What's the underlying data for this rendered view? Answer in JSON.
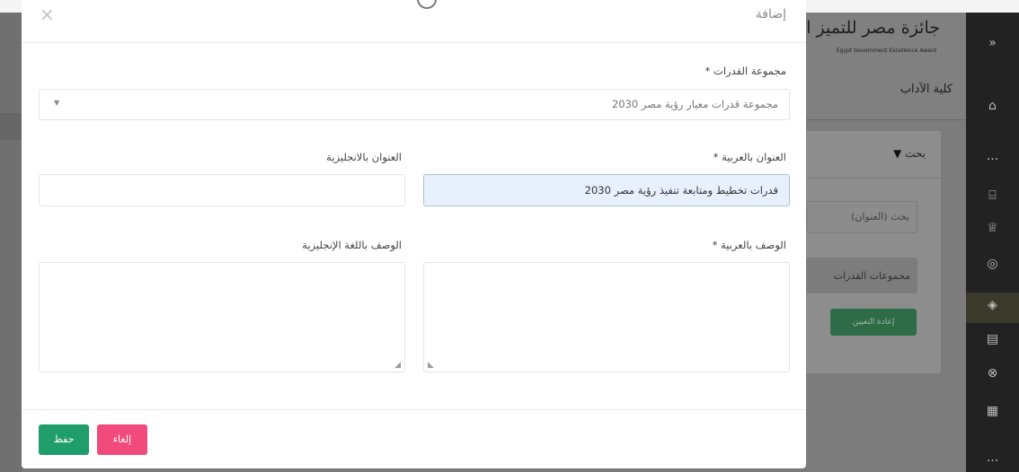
{
  "background": {
    "logo_script": "جائزة مصر للتميز الحكومي",
    "logo_award": "Egypt Government Excellence Award",
    "faculty": "كلية الآداب",
    "search_title": "بحث",
    "search_placeholder": "بحث (العنوان)",
    "groups_select": "مجموعات القدرات",
    "reset_button": "إعادة التعيين"
  },
  "modal": {
    "title": "إضافة",
    "close_symbol": "×",
    "capability_group": {
      "label": "مجموعة القدرات *",
      "selected": "مجموعة قدرات معيار رؤية مصر 2030"
    },
    "title_arabic": {
      "label": "العنوان بالعربية *",
      "value": "قدرات تخطيط ومتابعة تنفيذ رؤية مصر 2030"
    },
    "title_english": {
      "label": "العنوان بالانجليزية",
      "value": ""
    },
    "desc_arabic": {
      "label": "الوصف بالعربية *"
    },
    "desc_english": {
      "label": "الوصف باللغة الإنجليزية"
    },
    "cancel_label": "إلغاء",
    "save_label": "حفظ"
  },
  "colors": {
    "save": "#1f9d6a",
    "cancel": "#f04b7c",
    "rail": "#222222"
  }
}
